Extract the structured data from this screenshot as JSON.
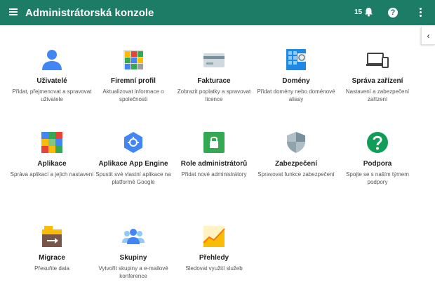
{
  "header": {
    "title": "Administrátorská konzole",
    "notification_count": "15",
    "help_label": "?",
    "colors": {
      "bar": "#1c7c66"
    }
  },
  "side_toggle": {
    "label": "‹"
  },
  "tiles": [
    {
      "icon": "user-icon",
      "title": "Uživatelé",
      "desc": "Přidat, přejmenovat a spravovat uživatele"
    },
    {
      "icon": "company-profile-icon",
      "title": "Firemní profil",
      "desc": "Aktualizovat informace o společnosti"
    },
    {
      "icon": "billing-card-icon",
      "title": "Fakturace",
      "desc": "Zobrazit poplatky a spravovat licence"
    },
    {
      "icon": "domains-icon",
      "title": "Domény",
      "desc": "Přidat domény nebo doménové aliasy"
    },
    {
      "icon": "devices-icon",
      "title": "Správa zařízení",
      "desc": "Nastavení a zabezpečení zařízení"
    },
    {
      "icon": "apps-grid-icon",
      "title": "Aplikace",
      "desc": "Správa aplikací a jejich nastavení"
    },
    {
      "icon": "app-engine-icon",
      "title": "Aplikace App Engine",
      "desc": "Spustit své vlastní aplikace na platformě Google"
    },
    {
      "icon": "admin-lock-icon",
      "title": "Role administrátorů",
      "desc": "Přidat nové administrátory"
    },
    {
      "icon": "security-shield-icon",
      "title": "Zabezpečení",
      "desc": "Spravovat funkce zabezpečení"
    },
    {
      "icon": "help-icon",
      "title": "Podpora",
      "desc": "Spojte se s naším týmem podpory"
    },
    {
      "icon": "migration-box-icon",
      "title": "Migrace",
      "desc": "Přesuňte data"
    },
    {
      "icon": "groups-icon",
      "title": "Skupiny",
      "desc": "Vytvořit skupiny a e-mailové konference"
    },
    {
      "icon": "reports-chart-icon",
      "title": "Přehledy",
      "desc": "Sledovat využití služeb"
    }
  ]
}
